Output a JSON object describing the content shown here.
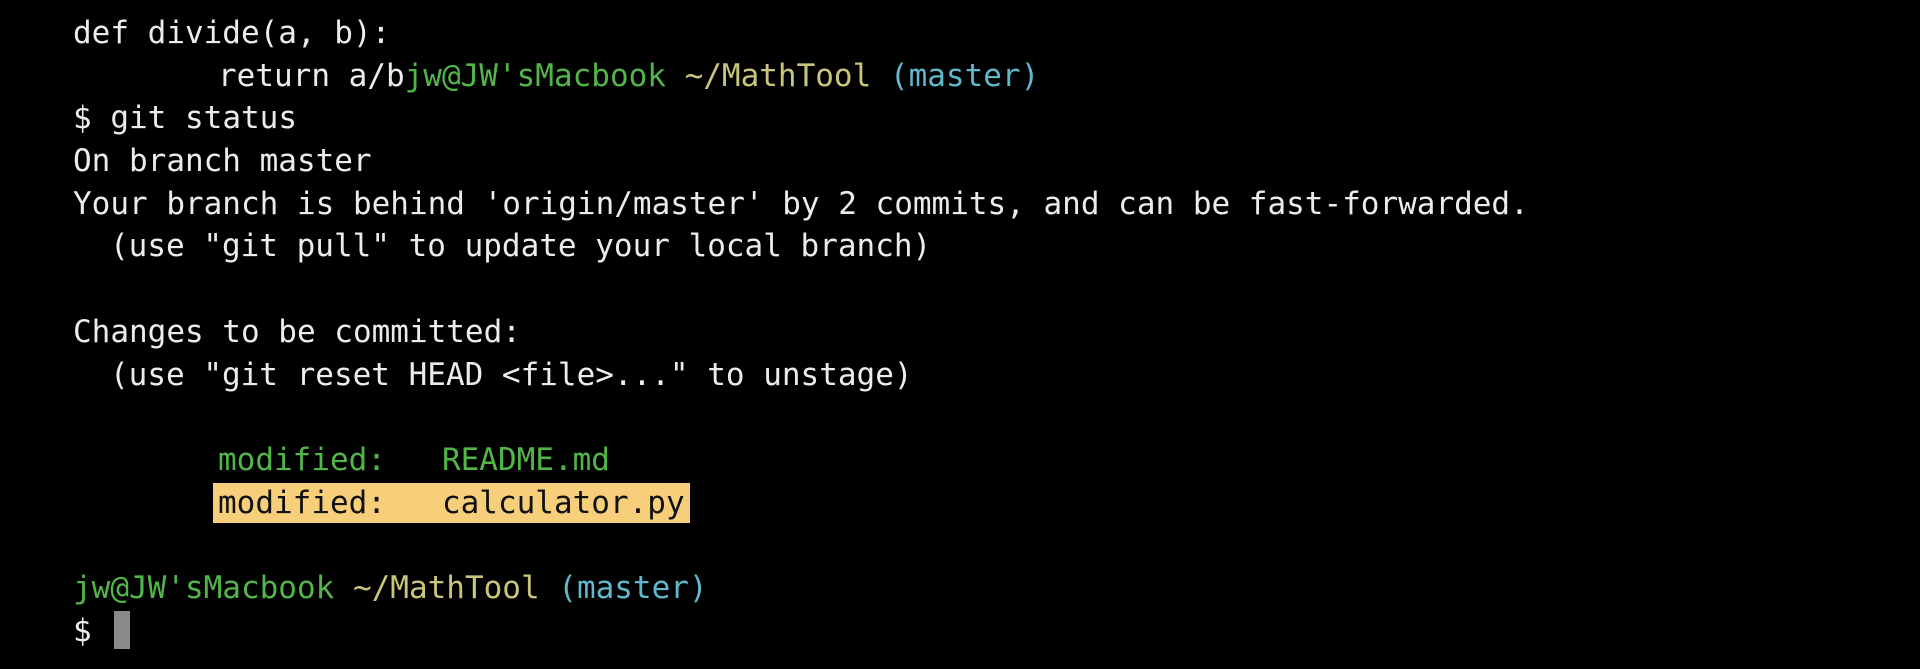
{
  "code": {
    "def_line": "def divide(a, b):",
    "return_line": "return a/b"
  },
  "prompt": {
    "user_host": "jw@JW'sMacbook",
    "path": "~/MathTool",
    "branch": "(master)",
    "symbol": "$"
  },
  "command": "git status",
  "output": {
    "on_branch": "On branch master",
    "behind": "Your branch is behind 'origin/master' by 2 commits, and can be fast-forwarded.",
    "pull_hint": "(use \"git pull\" to update your local branch)",
    "changes_header": "Changes to be committed:",
    "reset_hint": "(use \"git reset HEAD <file>...\" to unstage)",
    "files": [
      {
        "status": "modified:",
        "name": "README.md"
      },
      {
        "status": "modified:",
        "name": "calculator.py"
      }
    ]
  },
  "colors": {
    "background": "#000000",
    "text": "#ececec",
    "user_host": "#52b548",
    "path": "#c9c67c",
    "branch": "#5fb8cc",
    "staged_file": "#52b548",
    "highlight": "#f7cf7b",
    "cursor": "#8a8a8a"
  }
}
